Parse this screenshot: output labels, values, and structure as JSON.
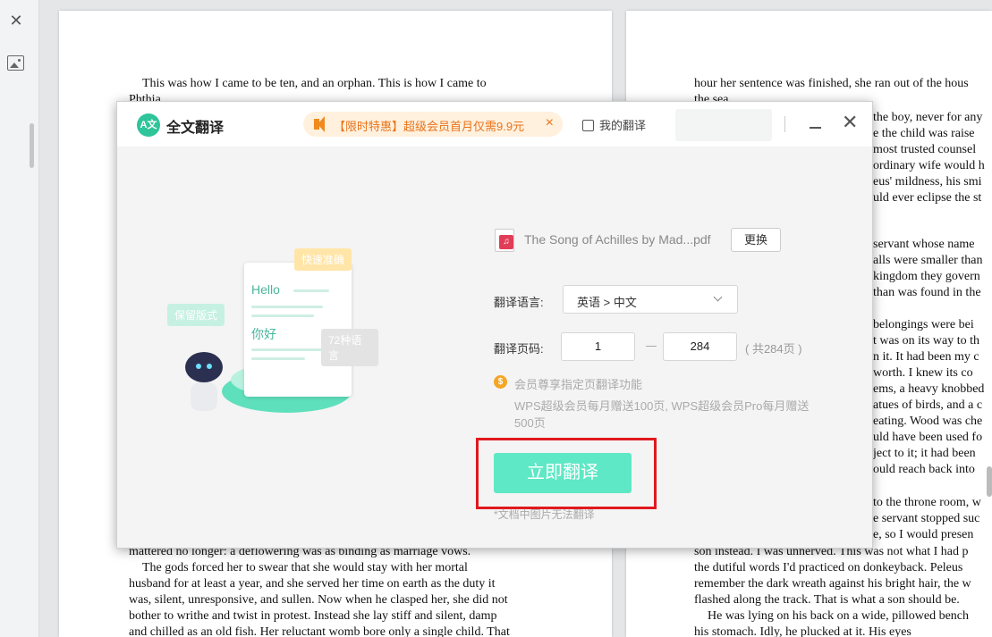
{
  "sidebar": {
    "close_icon": "close-icon",
    "image_icon": "image-icon"
  },
  "document": {
    "left_page_top_lines": [
      "This was how I came to be ten, and an orphan. This is how I came to",
      "Phthia."
    ],
    "left_page_bottom_lines": [
      "mattered no longer: a deflowering was as binding as marriage vows.",
      "The gods forced her to swear that she would stay with her mortal",
      "husband for at least a year, and she served her time on earth as the duty it",
      "was, silent, unresponsive, and sullen. Now when he clasped her, she did not",
      "bother to writhe and twist in protest. Instead she lay stiff and silent, damp",
      "and chilled as an old fish. Her reluctant womb bore only a single child. That"
    ],
    "right_page_top_lines": [
      "hour her sentence was finished, she ran out of the hous",
      "the sea."
    ],
    "right_page_side_lines": [
      "the boy, never for any",
      "e the child was raise",
      "most trusted counsel",
      "ordinary wife would h",
      "eus' mildness, his smi",
      "uld ever eclipse the st",
      "",
      "servant whose name",
      "alls were smaller than",
      "kingdom they govern",
      "than was found in the",
      "",
      "belongings were bei",
      "t was on its way to th",
      "n it. It had been my c",
      "worth. I knew its co",
      "ems, a heavy knobbed",
      "atues of birds, and a c",
      "eating. Wood was che",
      "uld have been used fo",
      "ject to it; it had been",
      "ould reach back into",
      "",
      "to the throne room, w",
      "e servant stopped suc",
      "e, so I would presen"
    ],
    "right_page_bottom_lines": [
      "son instead. I was unnerved. This was not what I had p",
      "the dutiful words I'd practiced on donkeyback. Peleus",
      "remember the dark wreath against his bright hair, the w",
      "flashed along the track. That is what a son should be.",
      "He was lying on his back on a wide, pillowed bench",
      "his stomach. Idly, he plucked at it. His eyes"
    ]
  },
  "dialog": {
    "logo_text": "A文",
    "title": "全文翻译",
    "promo": {
      "icon": "speaker-icon",
      "text": "【限时特惠】超级会员首月仅需9.9元",
      "close": "×"
    },
    "my_translations": "我的翻译",
    "illustration": {
      "tag_fast": "快速准确",
      "tag_layout": "保留版式",
      "tag_langs": "72种语言",
      "hello": "Hello",
      "nihao": "你好"
    },
    "file": {
      "icon": "pdf-file-icon",
      "name": "The Song of Achilles by Mad...pdf",
      "change_label": "更换"
    },
    "language": {
      "label": "翻译语言:",
      "value": "英语 > 中文"
    },
    "pages": {
      "label": "翻译页码:",
      "from": "1",
      "to": "284",
      "total": "( 共284页 )"
    },
    "vip": {
      "icon": "coin-icon",
      "title": "会员尊享指定页翻译功能",
      "desc": "WPS超级会员每月赠送100页, WPS超级会员Pro每月赠送500页"
    },
    "translate_button": "立即翻译",
    "note": "*文档中图片无法翻译"
  },
  "colors": {
    "accent": "#5ee8c5",
    "brand": "#2fc49a",
    "promo_text": "#e8731a",
    "highlight": "#e0191e"
  }
}
